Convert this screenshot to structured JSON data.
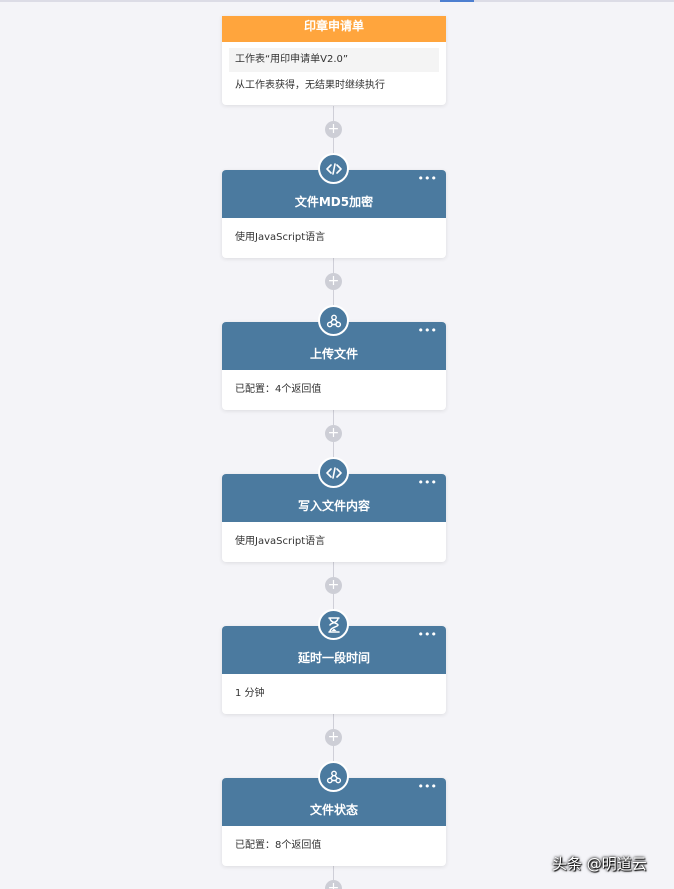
{
  "trigger": {
    "title": "印章申请单",
    "sheet_label": "工作表“用印申请单V2.0”",
    "description": "从工作表获得，无结果时继续执行",
    "color": "#ffa53d"
  },
  "nodes": [
    {
      "icon": "code-icon",
      "title": "文件MD5加密",
      "more": "•••",
      "body": "使用JavaScript语言"
    },
    {
      "icon": "webhook-icon",
      "title": "上传文件",
      "more": "•••",
      "body": "已配置：4个返回值"
    },
    {
      "icon": "code-icon",
      "title": "写入文件内容",
      "more": "•••",
      "body": "使用JavaScript语言"
    },
    {
      "icon": "hourglass-icon",
      "title": "延时一段时间",
      "more": "•••",
      "body": "1 分钟"
    },
    {
      "icon": "webhook-icon",
      "title": "文件状态",
      "more": "•••",
      "body": "已配置：8个返回值"
    }
  ],
  "add_label": "+",
  "node_color": "#4b7a9f",
  "watermark": "头条 @明道云"
}
